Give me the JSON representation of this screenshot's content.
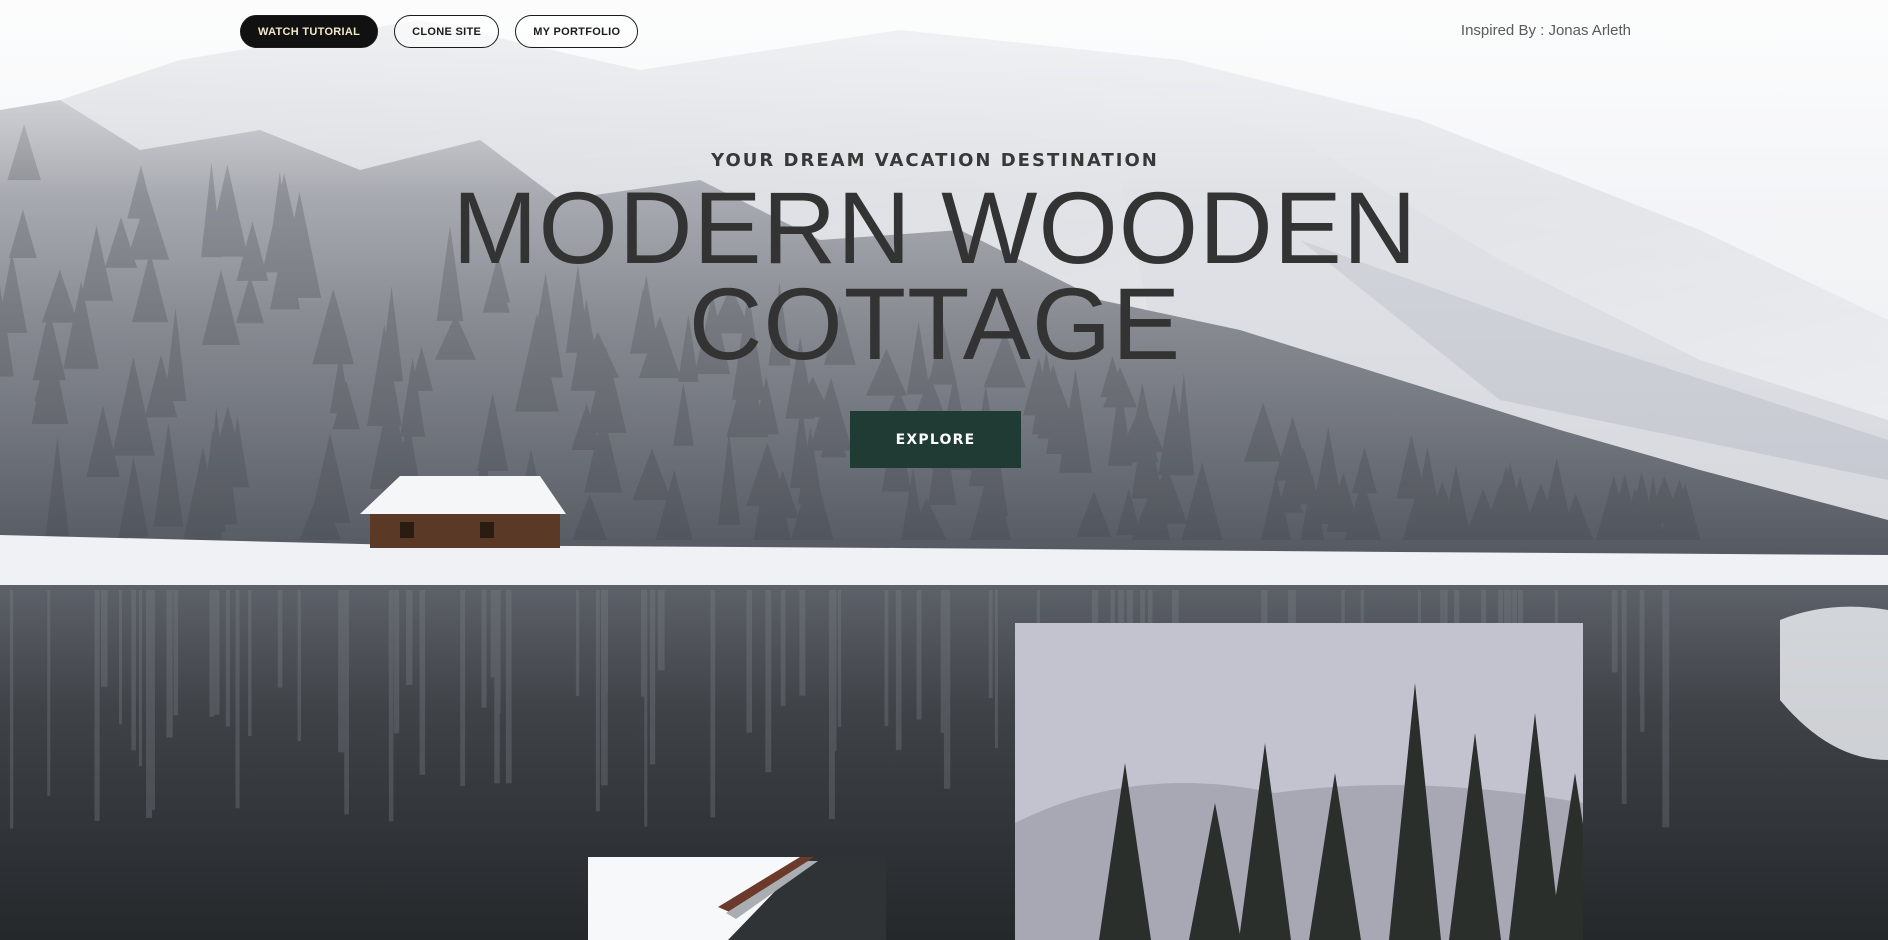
{
  "nav": {
    "watch_tutorial": "WATCH TUTORIAL",
    "clone_site": "CLONE SITE",
    "my_portfolio": "MY PORTFOLIO",
    "credit": "Inspired By : Jonas Arleth"
  },
  "hero": {
    "eyebrow": "YOUR DREAM VACATION DESTINATION",
    "title_line1": "MODERN WOODEN",
    "title_line2": "COTTAGE",
    "cta": "EXPLORE"
  },
  "colors": {
    "cta_background": "#1f3b33",
    "primary_button_background": "#111111",
    "primary_button_text": "#f2e7c9",
    "title_text": "#333333"
  }
}
